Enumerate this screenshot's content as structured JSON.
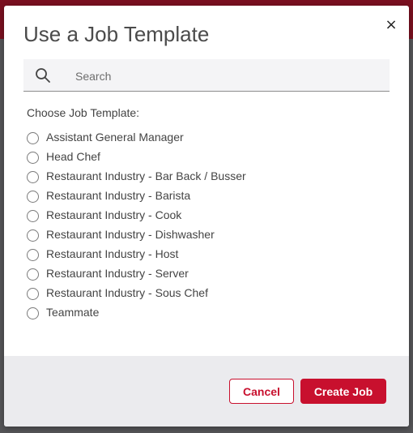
{
  "modal": {
    "title": "Use a Job Template",
    "close_icon": "×"
  },
  "search": {
    "placeholder": "Search",
    "value": ""
  },
  "choose_label": "Choose Job Template:",
  "templates": [
    "Assistant General Manager",
    "Head Chef",
    "Restaurant Industry - Bar Back / Busser",
    "Restaurant Industry - Barista",
    "Restaurant Industry - Cook",
    "Restaurant Industry - Dishwasher",
    "Restaurant Industry - Host",
    "Restaurant Industry - Server",
    "Restaurant Industry - Sous Chef",
    "Teammate"
  ],
  "footer": {
    "cancel_label": "Cancel",
    "create_label": "Create Job"
  },
  "colors": {
    "accent": "#c8102e",
    "footer_bg": "#ebebee",
    "search_bg": "#f4f4f6"
  },
  "icons": {
    "search": "search-icon",
    "close": "close-icon",
    "radio": "radio-unchecked-icon"
  }
}
